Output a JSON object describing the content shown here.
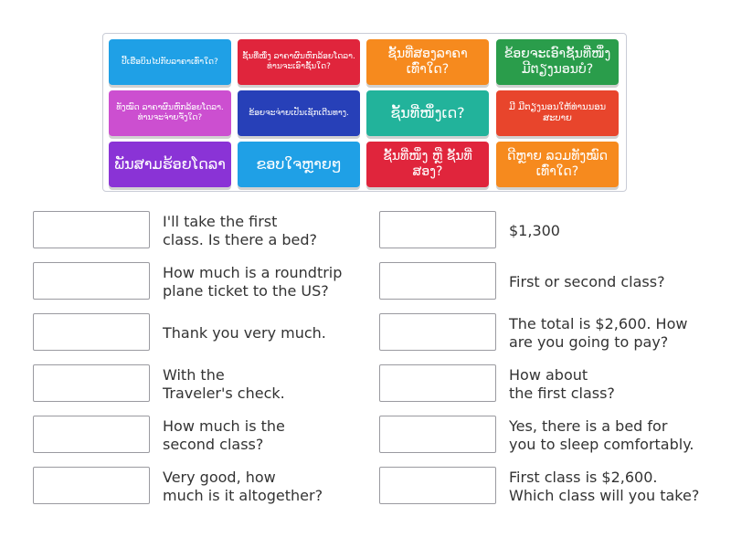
{
  "tiles": [
    {
      "text": "ປີ້ເຮືອບິນໄປກັບລາຄາເທົ່າໃດ?",
      "color": "#1fa0e6"
    },
    {
      "text": "ຊັ້ນທີ່ໜຶ່ງ ລາຄາຜົນຫົກລ້ອຍໂດລາ. ທ່ານຈະເອົາຊັ້ນໃດ?",
      "color": "#e0253c"
    },
    {
      "text": "ຊັ້ນທີ່ສອງລາຄາເທົ່າໃດ?",
      "color": "#f68a1e"
    },
    {
      "text": "ຂ້ອຍຈະເອົາຊັ້ນທີ່ໜຶ່ງ ມີຕຽງນອນບໍ?",
      "color": "#2a9d4b"
    },
    {
      "text": "ທັງໝົດ ລາຄາຜົນຫົກລ້ອຍໂດລາ. ທ່ານຈະຈ່າຍຈັ່ງໃດ?",
      "color": "#cc4fd0"
    },
    {
      "text": "ຂ້ອຍຈະຈ່າຍເປັນເຊັກເດີນທາງ.",
      "color": "#2740b8"
    },
    {
      "text": "ຊັ້ນທີ່ໜຶ່ງເດ?",
      "color": "#22b39b"
    },
    {
      "text": "ມີ ມີຕຽງນອນໃຫ້ທ່ານນອນສະບາຍ",
      "color": "#f68a1e"
    },
    {
      "text": "ພັນສາມຮ້ອຍໂດລາ",
      "color": "#8a33d6"
    },
    {
      "text": "ຂອບໃຈຫຼາຍໆ",
      "color": "#1fa0e6"
    },
    {
      "text": "ຊັ້ນທີ່ໜຶ່ງ ຫຼື ຊັ້ນທີ່ສອງ?",
      "color": "#e0253c"
    },
    {
      "text": "ດີຫຼາຍ ລວມທັງໝົດເທົ່າໃດ?",
      "color": "#f68a1e"
    }
  ],
  "left_prompts": [
    "I'll take the first\nclass. Is there a bed?",
    "How much is a roundtrip\nplane ticket to the US?",
    "Thank you very much.",
    "With the\nTraveler's check.",
    "How much is the\nsecond class?",
    "Very good, how\nmuch is it altogether?"
  ],
  "right_prompts": [
    "$1,300",
    "First or second class?",
    "The total is $2,600. How\nare you going to pay?",
    "How about\nthe first class?",
    "Yes, there is a bed for\nyou to sleep comfortably.",
    "First class is $2,600.\nWhich class will you take?"
  ]
}
